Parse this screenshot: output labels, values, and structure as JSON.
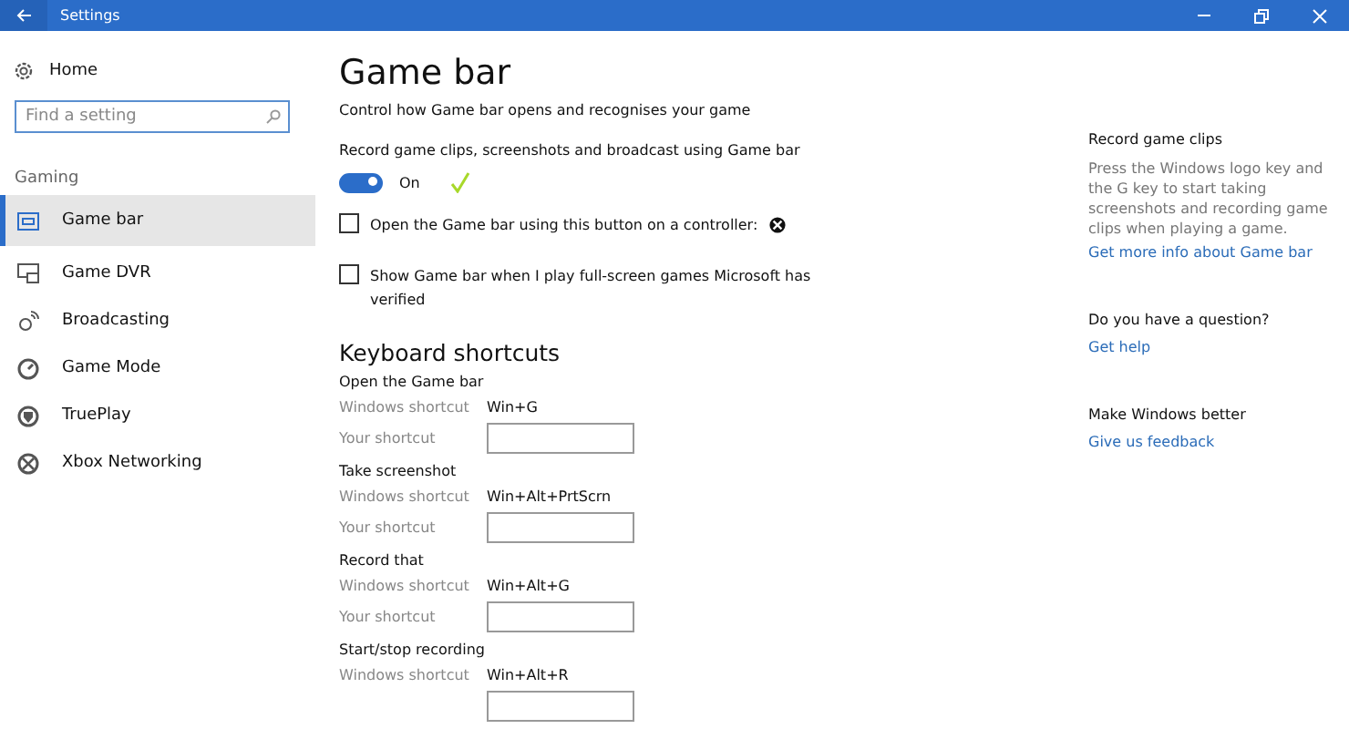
{
  "window": {
    "title": "Settings"
  },
  "sidebar": {
    "home": "Home",
    "search": {
      "placeholder": "Find a setting"
    },
    "section": "Gaming",
    "items": [
      {
        "label": "Game bar",
        "selected": true
      },
      {
        "label": "Game DVR",
        "selected": false
      },
      {
        "label": "Broadcasting",
        "selected": false
      },
      {
        "label": "Game Mode",
        "selected": false
      },
      {
        "label": "TruePlay",
        "selected": false
      },
      {
        "label": "Xbox Networking",
        "selected": false
      }
    ]
  },
  "main": {
    "title": "Game bar",
    "description": "Control how Game bar opens and recognises your game",
    "toggle": {
      "label": "Record game clips, screenshots and broadcast using Game bar",
      "on": true,
      "state_text": "On"
    },
    "checkboxes": [
      {
        "label": "Open the Game bar using this button on a controller:",
        "checked": false
      },
      {
        "label": "Show Game bar when I play full-screen games Microsoft has verified",
        "checked": false
      }
    ],
    "shortcuts": {
      "heading": "Keyboard shortcuts",
      "groups": [
        {
          "name": "Open the Game bar",
          "windows_label": "Windows shortcut",
          "windows_value": "Win+G",
          "your_label": "Your shortcut"
        },
        {
          "name": "Take screenshot",
          "windows_label": "Windows shortcut",
          "windows_value": "Win+Alt+PrtScrn",
          "your_label": "Your shortcut"
        },
        {
          "name": "Record that",
          "windows_label": "Windows shortcut",
          "windows_value": "Win+Alt+G",
          "your_label": "Your shortcut"
        },
        {
          "name": "Start/stop recording",
          "windows_label": "Windows shortcut",
          "windows_value": "Win+Alt+R"
        }
      ]
    }
  },
  "info": [
    {
      "heading": "Record game clips",
      "text": "Press the Windows logo key and the G key to start taking screenshots and recording game clips when playing a game.",
      "link": "Get more info about Game bar"
    },
    {
      "heading": "Do you have a question?",
      "link": "Get help"
    },
    {
      "heading": "Make Windows better",
      "link": "Give us feedback"
    }
  ]
}
